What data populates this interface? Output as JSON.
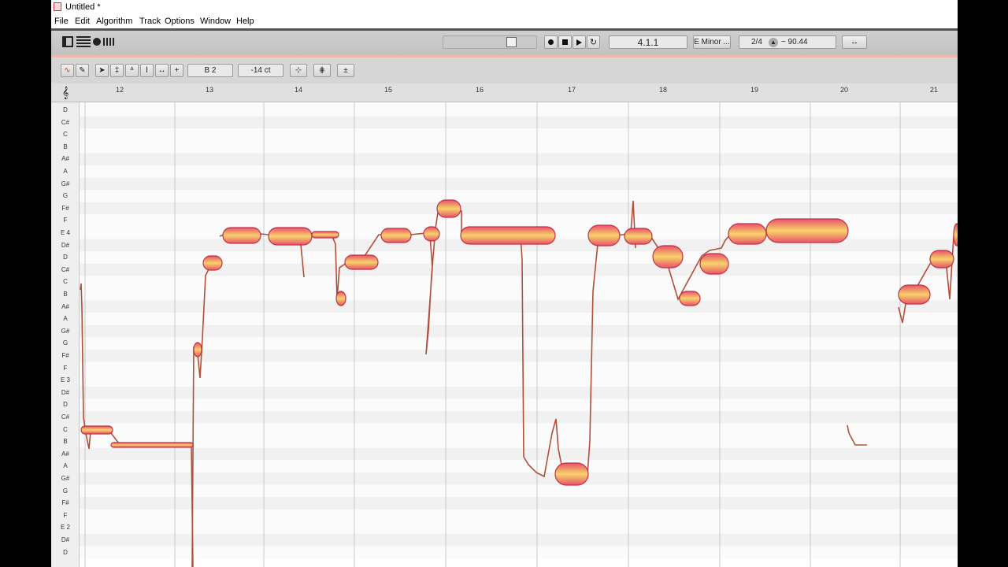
{
  "window": {
    "title": "Untitled *"
  },
  "menu": [
    "File",
    "Edit",
    "Algorithm",
    "Track",
    "Options",
    "Window",
    "Help"
  ],
  "transport": {
    "position": "4.1.1",
    "key": "E Minor ...",
    "time_signature": "2/4",
    "tempo": "~ 90.44"
  },
  "edit": {
    "note": "B 2",
    "cents": "-14 ct"
  },
  "ruler": {
    "bars": [
      "12",
      "13",
      "14",
      "15",
      "16",
      "17",
      "18",
      "19",
      "20",
      "21"
    ]
  },
  "keyboard": [
    "D",
    "C#",
    "C",
    "B",
    "A#",
    "A",
    "G#",
    "G",
    "F#",
    "F",
    "E 4",
    "D#",
    "D",
    "C#",
    "C",
    "B",
    "A#",
    "A",
    "G#",
    "G",
    "F#",
    "F",
    "E 3",
    "D#",
    "D",
    "C#",
    "C",
    "B",
    "A#",
    "A",
    "G#",
    "G",
    "F#",
    "F",
    "E 2",
    "D#",
    "D"
  ],
  "colors": {
    "accent": "#e8a060",
    "blob_fill": "#f5c04a",
    "blob_edge": "#c0304a",
    "pitch_line": "#b0503a"
  },
  "icons": {
    "clef": "clef-icon",
    "pointer": "pointer-icon",
    "pitch": "pitch-tool-icon"
  }
}
